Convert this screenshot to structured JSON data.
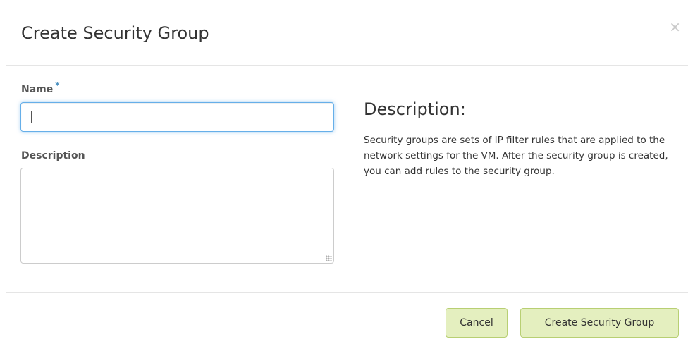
{
  "modal": {
    "title": "Create Security Group",
    "close_icon": "close-icon",
    "close_glyph": "×"
  },
  "form": {
    "name_label": "Name",
    "required_marker": "*",
    "name_value": "",
    "description_label": "Description",
    "description_value": ""
  },
  "help": {
    "title": "Description:",
    "text": "Security groups are sets of IP filter rules that are applied to the network settings for the VM. After the security group is created, you can add rules to the security group."
  },
  "footer": {
    "cancel_label": "Cancel",
    "submit_label": "Create Security Group"
  },
  "colors": {
    "button_bg": "#e4efbf",
    "button_border": "#b8cf73",
    "focus_border": "#66afe9",
    "required_star": "#4a90c0"
  }
}
